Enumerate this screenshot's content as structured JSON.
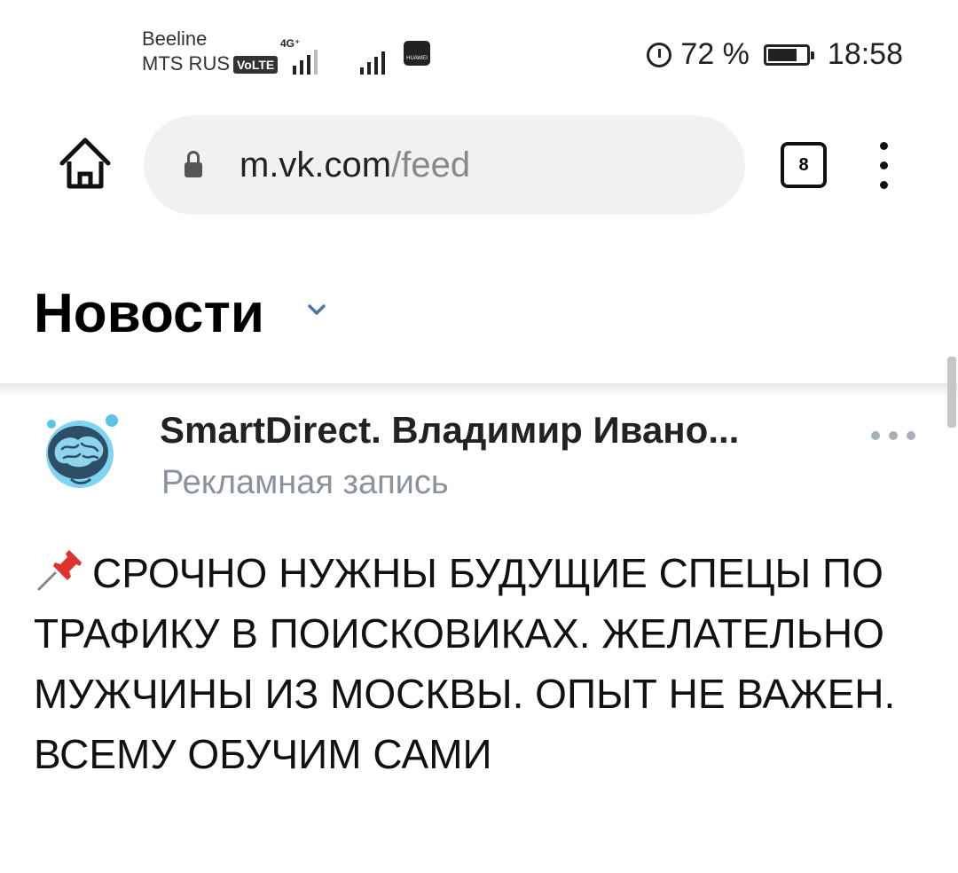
{
  "status_bar": {
    "carrier_1": "Beeline",
    "carrier_2": "MTS RUS",
    "volte": "VoLTE",
    "network": "4G⁺",
    "brand": "HUAWEI",
    "battery": "72 %",
    "time": "18:58"
  },
  "browser": {
    "url_host": "m.vk.com",
    "url_path": "/feed",
    "tab_count": "8"
  },
  "page": {
    "title": "Новости"
  },
  "post": {
    "author": "SmartDirect. Владимир Ивано...",
    "subtitle": "Рекламная запись",
    "text": "СРОЧНО НУЖНЫ БУДУЩИЕ СПЕЦЫ ПО ТРАФИКУ В ПОИСКОВИКАХ. ЖЕЛАТЕЛЬНО МУЖЧИНЫ ИЗ МОСКВЫ. ОПЫТ НЕ ВАЖЕН. ВСЕМУ ОБУЧИМ САМИ"
  },
  "icons": {
    "home": "home-icon",
    "lock": "lock-icon",
    "menu": "more-vertical-icon",
    "title_chevron": "chevron-down-icon",
    "post_menu": "more-horizontal-icon",
    "pin": "pushpin-emoji",
    "avatar": "brain-logo"
  },
  "colors": {
    "accent": "#4a76a8",
    "subtitle": "#8a939d",
    "url_bar": "#f1f1f1"
  }
}
